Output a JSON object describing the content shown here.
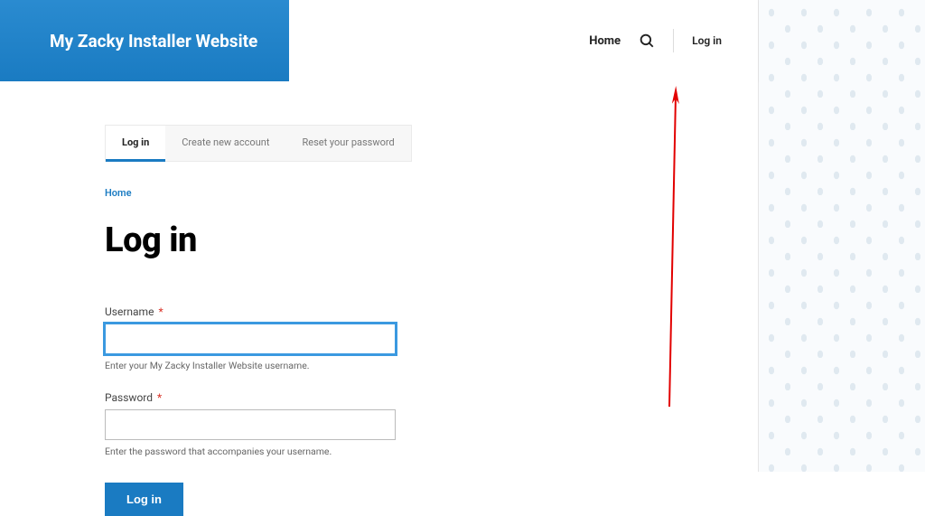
{
  "header": {
    "site_title": "My Zacky Installer Website",
    "nav_home": "Home",
    "nav_login": "Log in"
  },
  "tabs": [
    {
      "label": "Log in",
      "active": true
    },
    {
      "label": "Create new account",
      "active": false
    },
    {
      "label": "Reset your password",
      "active": false
    }
  ],
  "breadcrumb": "Home",
  "page_title": "Log in",
  "form": {
    "username": {
      "label": "Username",
      "required": "*",
      "value": "",
      "help": "Enter your My Zacky Installer Website username."
    },
    "password": {
      "label": "Password",
      "required": "*",
      "value": "",
      "help": "Enter the password that accompanies your username."
    },
    "submit": "Log in"
  },
  "colors": {
    "primary": "#1a7bc2",
    "focus": "#3b99e0"
  }
}
